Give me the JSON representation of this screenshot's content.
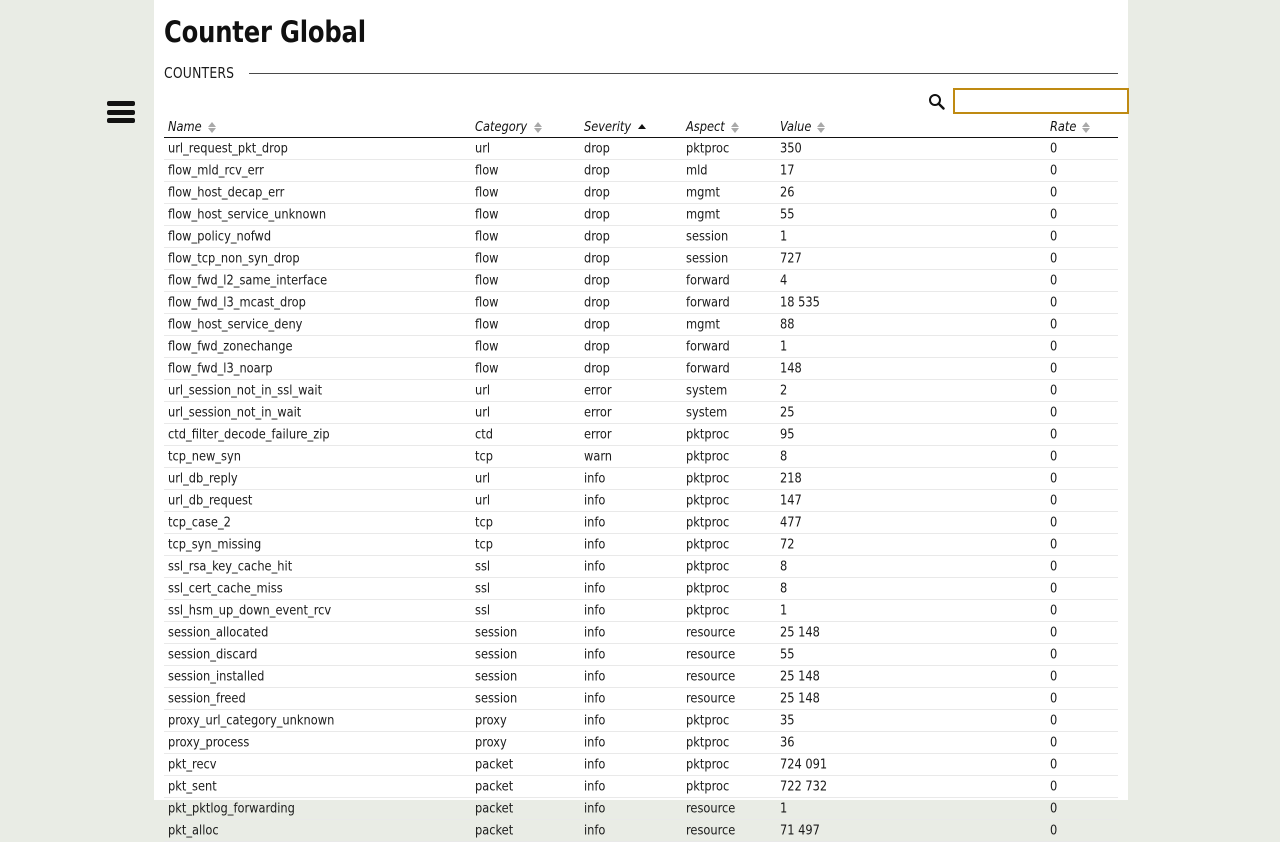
{
  "page": {
    "title": "Counter Global",
    "section_label": "COUNTERS",
    "background_color": "#e9ece5",
    "panel_color": "#ffffff",
    "accent_color": "#bf8a12"
  },
  "menu": {
    "icon": "hamburger-menu-icon"
  },
  "search": {
    "icon": "search-icon",
    "value": "",
    "placeholder": ""
  },
  "table": {
    "columns": [
      {
        "key": "name",
        "label": "Name",
        "sort": "none"
      },
      {
        "key": "category",
        "label": "Category",
        "sort": "none"
      },
      {
        "key": "severity",
        "label": "Severity",
        "sort": "asc"
      },
      {
        "key": "aspect",
        "label": "Aspect",
        "sort": "none"
      },
      {
        "key": "value",
        "label": "Value",
        "sort": "none"
      },
      {
        "key": "rate",
        "label": "Rate",
        "sort": "none"
      }
    ],
    "rows": [
      {
        "name": "url_request_pkt_drop",
        "category": "url",
        "severity": "drop",
        "aspect": "pktproc",
        "value": "350",
        "rate": "0"
      },
      {
        "name": "flow_mld_rcv_err",
        "category": "flow",
        "severity": "drop",
        "aspect": "mld",
        "value": "17",
        "rate": "0"
      },
      {
        "name": "flow_host_decap_err",
        "category": "flow",
        "severity": "drop",
        "aspect": "mgmt",
        "value": "26",
        "rate": "0"
      },
      {
        "name": "flow_host_service_unknown",
        "category": "flow",
        "severity": "drop",
        "aspect": "mgmt",
        "value": "55",
        "rate": "0"
      },
      {
        "name": "flow_policy_nofwd",
        "category": "flow",
        "severity": "drop",
        "aspect": "session",
        "value": "1",
        "rate": "0"
      },
      {
        "name": "flow_tcp_non_syn_drop",
        "category": "flow",
        "severity": "drop",
        "aspect": "session",
        "value": "727",
        "rate": "0"
      },
      {
        "name": "flow_fwd_l2_same_interface",
        "category": "flow",
        "severity": "drop",
        "aspect": "forward",
        "value": "4",
        "rate": "0"
      },
      {
        "name": "flow_fwd_l3_mcast_drop",
        "category": "flow",
        "severity": "drop",
        "aspect": "forward",
        "value": "18 535",
        "rate": "0"
      },
      {
        "name": "flow_host_service_deny",
        "category": "flow",
        "severity": "drop",
        "aspect": "mgmt",
        "value": "88",
        "rate": "0"
      },
      {
        "name": "flow_fwd_zonechange",
        "category": "flow",
        "severity": "drop",
        "aspect": "forward",
        "value": "1",
        "rate": "0"
      },
      {
        "name": "flow_fwd_l3_noarp",
        "category": "flow",
        "severity": "drop",
        "aspect": "forward",
        "value": "148",
        "rate": "0"
      },
      {
        "name": "url_session_not_in_ssl_wait",
        "category": "url",
        "severity": "error",
        "aspect": "system",
        "value": "2",
        "rate": "0"
      },
      {
        "name": "url_session_not_in_wait",
        "category": "url",
        "severity": "error",
        "aspect": "system",
        "value": "25",
        "rate": "0"
      },
      {
        "name": "ctd_filter_decode_failure_zip",
        "category": "ctd",
        "severity": "error",
        "aspect": "pktproc",
        "value": "95",
        "rate": "0"
      },
      {
        "name": "tcp_new_syn",
        "category": "tcp",
        "severity": "warn",
        "aspect": "pktproc",
        "value": "8",
        "rate": "0"
      },
      {
        "name": "url_db_reply",
        "category": "url",
        "severity": "info",
        "aspect": "pktproc",
        "value": "218",
        "rate": "0"
      },
      {
        "name": "url_db_request",
        "category": "url",
        "severity": "info",
        "aspect": "pktproc",
        "value": "147",
        "rate": "0"
      },
      {
        "name": "tcp_case_2",
        "category": "tcp",
        "severity": "info",
        "aspect": "pktproc",
        "value": "477",
        "rate": "0"
      },
      {
        "name": "tcp_syn_missing",
        "category": "tcp",
        "severity": "info",
        "aspect": "pktproc",
        "value": "72",
        "rate": "0"
      },
      {
        "name": "ssl_rsa_key_cache_hit",
        "category": "ssl",
        "severity": "info",
        "aspect": "pktproc",
        "value": "8",
        "rate": "0"
      },
      {
        "name": "ssl_cert_cache_miss",
        "category": "ssl",
        "severity": "info",
        "aspect": "pktproc",
        "value": "8",
        "rate": "0"
      },
      {
        "name": "ssl_hsm_up_down_event_rcv",
        "category": "ssl",
        "severity": "info",
        "aspect": "pktproc",
        "value": "1",
        "rate": "0"
      },
      {
        "name": "session_allocated",
        "category": "session",
        "severity": "info",
        "aspect": "resource",
        "value": "25 148",
        "rate": "0"
      },
      {
        "name": "session_discard",
        "category": "session",
        "severity": "info",
        "aspect": "resource",
        "value": "55",
        "rate": "0"
      },
      {
        "name": "session_installed",
        "category": "session",
        "severity": "info",
        "aspect": "resource",
        "value": "25 148",
        "rate": "0"
      },
      {
        "name": "session_freed",
        "category": "session",
        "severity": "info",
        "aspect": "resource",
        "value": "25 148",
        "rate": "0"
      },
      {
        "name": "proxy_url_category_unknown",
        "category": "proxy",
        "severity": "info",
        "aspect": "pktproc",
        "value": "35",
        "rate": "0"
      },
      {
        "name": "proxy_process",
        "category": "proxy",
        "severity": "info",
        "aspect": "pktproc",
        "value": "36",
        "rate": "0"
      },
      {
        "name": "pkt_recv",
        "category": "packet",
        "severity": "info",
        "aspect": "pktproc",
        "value": "724 091",
        "rate": "0"
      },
      {
        "name": "pkt_sent",
        "category": "packet",
        "severity": "info",
        "aspect": "pktproc",
        "value": "722 732",
        "rate": "0"
      },
      {
        "name": "pkt_pktlog_forwarding",
        "category": "packet",
        "severity": "info",
        "aspect": "resource",
        "value": "1",
        "rate": "0"
      },
      {
        "name": "pkt_alloc",
        "category": "packet",
        "severity": "info",
        "aspect": "resource",
        "value": "71 497",
        "rate": "0"
      }
    ]
  }
}
